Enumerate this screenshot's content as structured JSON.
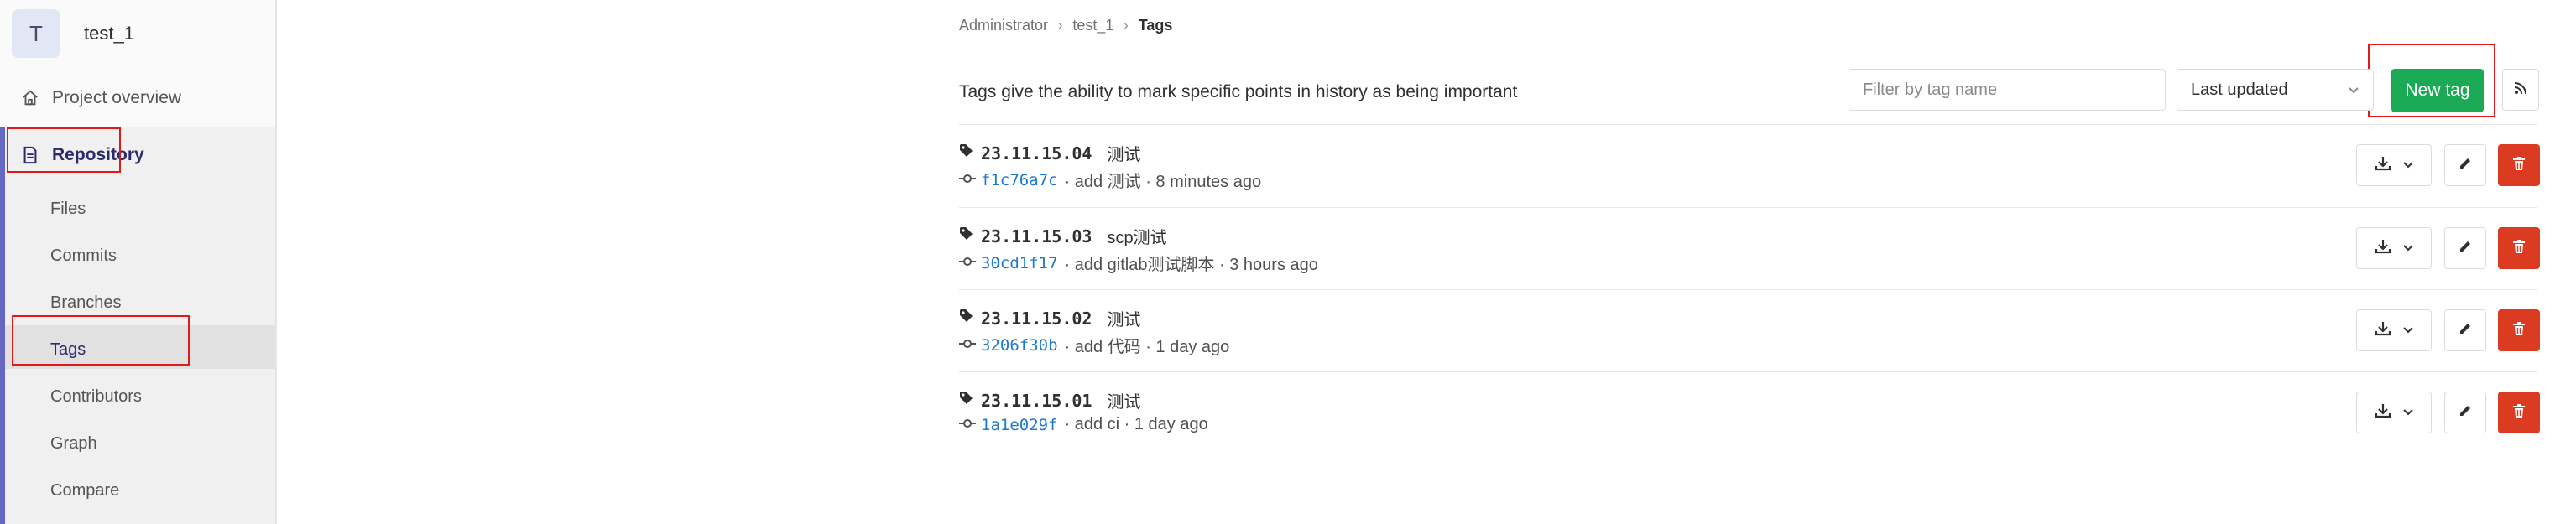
{
  "project": {
    "avatar_letter": "T",
    "name": "test_1"
  },
  "sidebar": {
    "overview_label": "Project overview",
    "repository_label": "Repository",
    "sub_items": [
      "Files",
      "Commits",
      "Branches",
      "Tags",
      "Contributors",
      "Graph",
      "Compare"
    ],
    "active_sub_item": "Tags"
  },
  "breadcrumb": [
    "Administrator",
    "test_1",
    "Tags"
  ],
  "header": {
    "description": "Tags give the ability to mark specific points in history as being important",
    "filter_placeholder": "Filter by tag name",
    "sort_label": "Last updated",
    "new_tag_label": "New tag"
  },
  "tags": [
    {
      "name": "23.11.15.04",
      "message": "测试",
      "sha": "f1c76a7c",
      "commit_info": "· add 测试 · 8 minutes ago"
    },
    {
      "name": "23.11.15.03",
      "message": "scp测试",
      "sha": "30cd1f17",
      "commit_info": "· add gitlab测试脚本 · 3 hours ago"
    },
    {
      "name": "23.11.15.02",
      "message": "测试",
      "sha": "3206f30b",
      "commit_info": "· add 代码 · 1 day ago"
    },
    {
      "name": "23.11.15.01",
      "message": "测试",
      "sha": "1a1e029f",
      "commit_info": "· add ci · 1 day ago"
    }
  ],
  "colors": {
    "accent_green": "#1aaa55",
    "danger_red": "#db3b21",
    "sidebar_active": "#6666c4",
    "link_blue": "#1f78d1",
    "highlight_red": "#e01919"
  }
}
